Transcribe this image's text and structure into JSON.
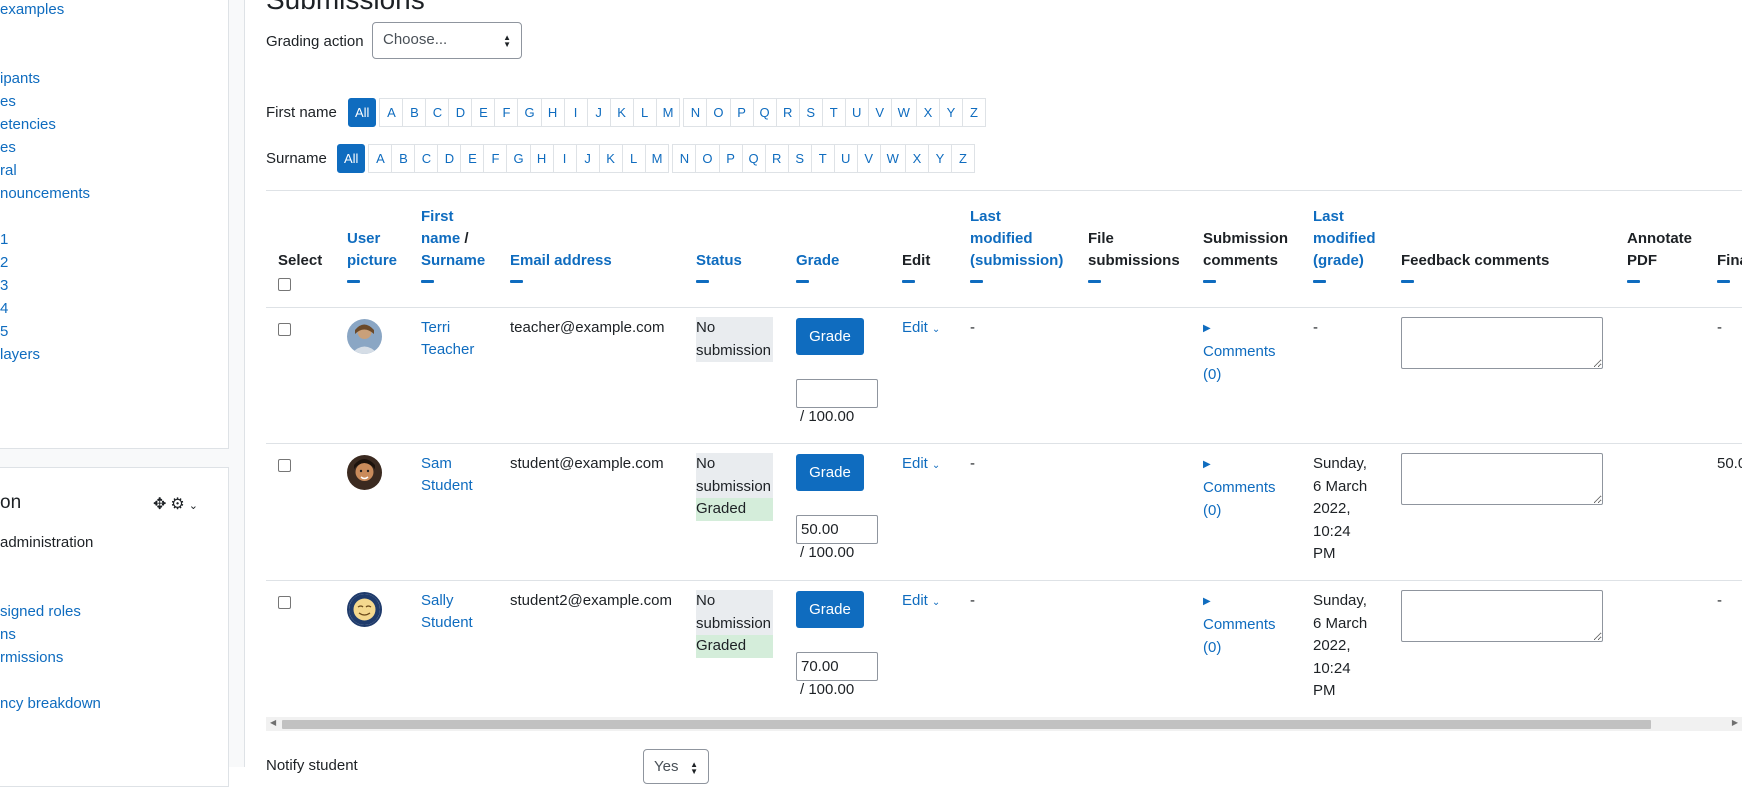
{
  "drawer": {
    "nav_links": [
      "examples",
      "ipants",
      "es",
      "etencies",
      "es",
      "ral",
      "nouncements",
      "1",
      "2",
      "3",
      "4",
      "5",
      "layers"
    ],
    "admin_title": "on",
    "admin_text": "administration",
    "admin_links": [
      "signed roles",
      "ns",
      "rmissions",
      "ncy breakdown"
    ]
  },
  "main": {
    "heading": "Submissions",
    "grading_action_label": "Grading action",
    "grading_action_value": "Choose...",
    "first_name_label": "First name",
    "surname_label": "Surname",
    "initials_all": "All",
    "initials": [
      "A",
      "B",
      "C",
      "D",
      "E",
      "F",
      "G",
      "H",
      "I",
      "J",
      "K",
      "L",
      "M",
      "N",
      "O",
      "P",
      "Q",
      "R",
      "S",
      "T",
      "U",
      "V",
      "W",
      "X",
      "Y",
      "Z"
    ],
    "notify_label": "Notify student",
    "notify_value": "Yes"
  },
  "table": {
    "headers": {
      "select": "Select",
      "user_picture_1": "User",
      "user_picture_2": "picture",
      "first_name_1": "First",
      "first_name_2": "name",
      "slash": " /",
      "surname": "Surname",
      "email": "Email address",
      "status": "Status",
      "grade": "Grade",
      "edit": "Edit",
      "last_mod_sub_1": "Last",
      "last_mod_sub_2": "modified",
      "last_mod_sub_3": "(submission)",
      "file_sub_1": "File",
      "file_sub_2": "submissions",
      "sub_comments_1": "Submission",
      "sub_comments_2": "comments",
      "last_mod_grade_1": "Last",
      "last_mod_grade_2": "modified",
      "last_mod_grade_3": "(grade)",
      "feedback": "Feedback comments",
      "annotate_1": "Annotate",
      "annotate_2": "PDF",
      "final": "Fina"
    },
    "grade_button": "Grade",
    "edit_label": "Edit",
    "comments_label": "Comments",
    "comments_count": "(0)",
    "status_no_1": "No",
    "status_no_2": "submission",
    "status_graded": "Graded",
    "rows": [
      {
        "first": "Terri",
        "last": "Teacher",
        "email": "teacher@example.com",
        "grade_value": "",
        "out_of": "/ 100.00",
        "last_modified_submission": "-",
        "last_modified_grade": [
          "-"
        ],
        "final": "-",
        "graded": false
      },
      {
        "first": "Sam",
        "last": "Student",
        "email": "student@example.com",
        "grade_value": "50.00",
        "out_of": "/ 100.00",
        "last_modified_submission": "-",
        "last_modified_grade": [
          "Sunday,",
          "6 March",
          "2022,",
          "10:24",
          "PM"
        ],
        "final": "50.0",
        "graded": true
      },
      {
        "first": "Sally",
        "last": "Student",
        "email": "student2@example.com",
        "grade_value": "70.00",
        "out_of": "/ 100.00",
        "last_modified_submission": "-",
        "last_modified_grade": [
          "Sunday,",
          "6 March",
          "2022,",
          "10:24",
          "PM"
        ],
        "final": "-",
        "graded": true
      }
    ]
  },
  "colors": {
    "link": "#0f6cbf",
    "graded_bg": "#d4edda",
    "status_bg": "#e9ecef"
  }
}
